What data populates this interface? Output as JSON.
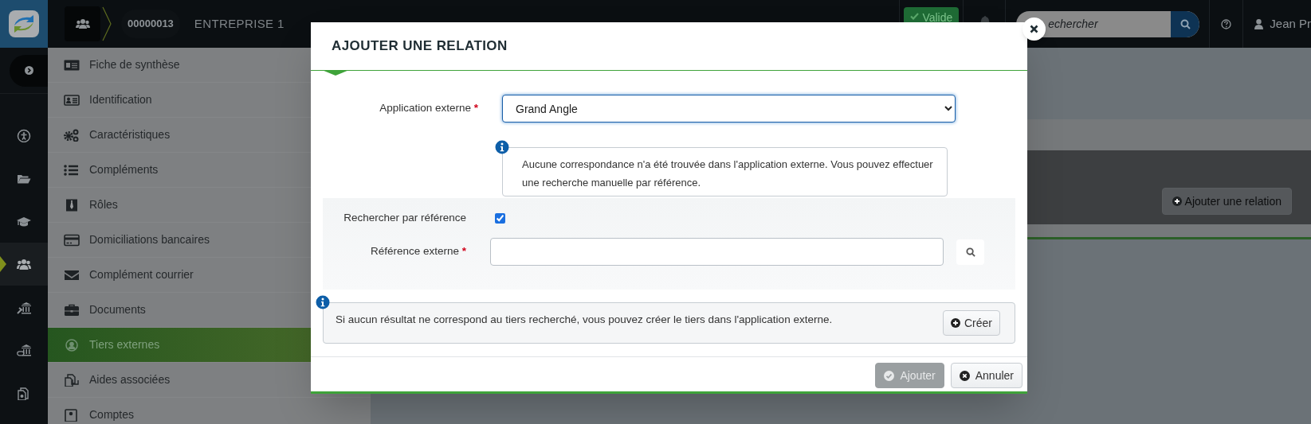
{
  "header": {
    "record_number": "00000013",
    "record_name": "ENTREPRISE 1",
    "status_button": "Valide",
    "search": {
      "placeholder": "echercher"
    },
    "user_name": "Jean Pr"
  },
  "rail_items": [
    {
      "selected": false
    },
    {
      "selected": false
    },
    {
      "selected": false
    },
    {
      "selected": true
    },
    {
      "selected": false
    },
    {
      "selected": false
    },
    {
      "selected": false
    }
  ],
  "menu": [
    {
      "label": "Fiche de synthèse",
      "selected": false
    },
    {
      "label": "Identification",
      "selected": false
    },
    {
      "label": "Caractéristiques",
      "selected": false
    },
    {
      "label": "Compléments",
      "selected": false
    },
    {
      "label": "Rôles",
      "selected": false
    },
    {
      "label": "Domiciliations bancaires",
      "selected": false
    },
    {
      "label": "Complément courrier",
      "selected": false
    },
    {
      "label": "Documents",
      "selected": false
    },
    {
      "label": "Tiers externes",
      "selected": true
    },
    {
      "label": "Aides associées",
      "selected": false
    },
    {
      "label": "Comptes",
      "selected": false
    }
  ],
  "panel": {
    "button": "Ajouter une relation"
  },
  "modal": {
    "title": "AJOUTER UNE RELATION",
    "application": {
      "label": "Application externe",
      "required_mark": "*",
      "value": "Grand Angle"
    },
    "notice": "Aucune correspondance n'a été trouvée dans l'application externe. Vous pouvez effectuer une recherche manuelle par référence.",
    "search_by_reference": {
      "label": "Rechercher par référence",
      "checked": true
    },
    "reference": {
      "label": "Référence externe",
      "required_mark": "*"
    },
    "create_notice": "Si aucun résultat ne correspond au tiers recherché, vous pouvez créer le tiers dans l'application externe.",
    "create_button": "Créer",
    "buttons": [
      {
        "label": "Ajouter",
        "kind": "primary",
        "disabled": true
      },
      {
        "label": "Annuler",
        "kind": "cancel",
        "disabled": false
      }
    ]
  }
}
